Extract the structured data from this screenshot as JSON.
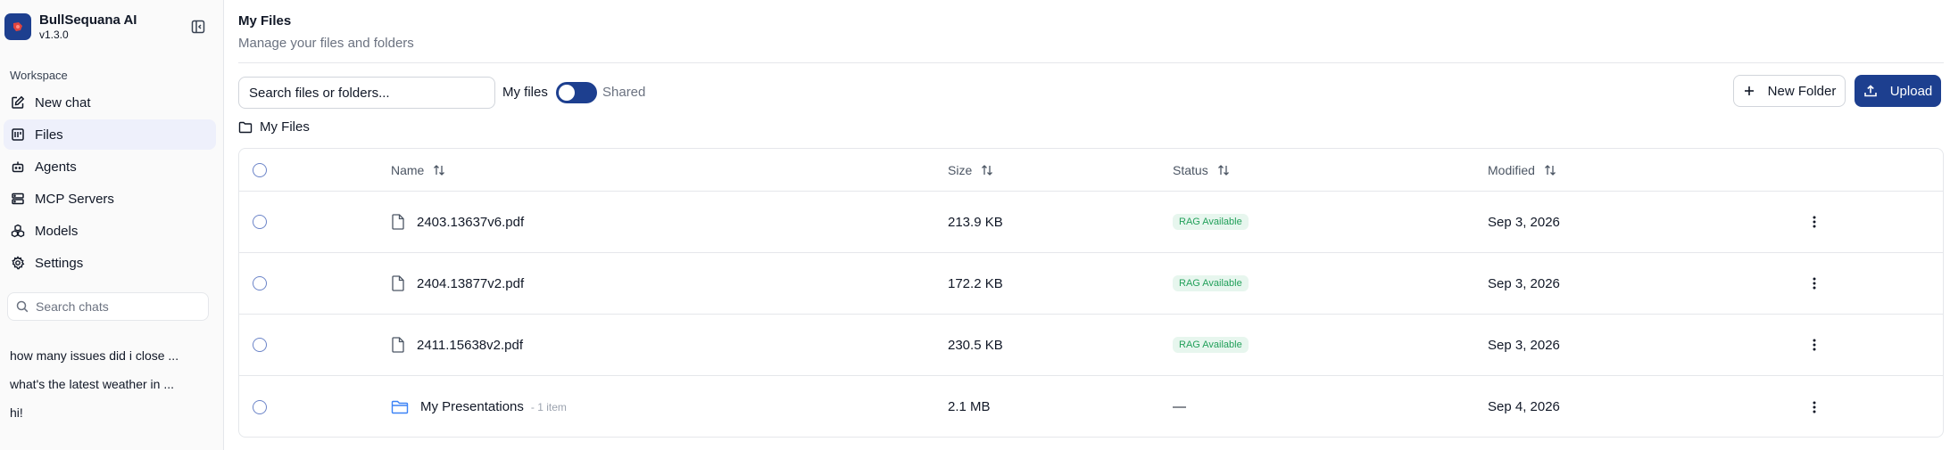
{
  "app": {
    "name": "BullSequana AI",
    "version": "v1.3.0"
  },
  "sidebar": {
    "workspace_label": "Workspace",
    "items": [
      {
        "label": "New chat",
        "icon": "edit-icon"
      },
      {
        "label": "Files",
        "icon": "files-icon",
        "active": true
      },
      {
        "label": "Agents",
        "icon": "bot-icon"
      },
      {
        "label": "MCP Servers",
        "icon": "server-icon"
      },
      {
        "label": "Models",
        "icon": "cubes-icon"
      },
      {
        "label": "Settings",
        "icon": "gear-icon"
      }
    ],
    "search_placeholder": "Search chats",
    "history": [
      "how many issues did i close ...",
      "what's the latest weather in ...",
      "hi!"
    ]
  },
  "page": {
    "title": "My Files",
    "subtitle": "Manage your files and folders"
  },
  "toolbar": {
    "search_placeholder": "Search files or folders...",
    "my_files_label": "My files",
    "shared_label": "Shared",
    "toggle_on": true,
    "new_folder_label": "New Folder",
    "upload_label": "Upload"
  },
  "breadcrumb": {
    "label": "My Files"
  },
  "table": {
    "columns": {
      "name": "Name",
      "size": "Size",
      "status": "Status",
      "modified": "Modified"
    },
    "rows": [
      {
        "type": "file",
        "name": "2403.13637v6.pdf",
        "count": "",
        "size": "213.9 KB",
        "status": "RAG Available",
        "modified": "Sep 3, 2026"
      },
      {
        "type": "file",
        "name": "2404.13877v2.pdf",
        "count": "",
        "size": "172.2 KB",
        "status": "RAG Available",
        "modified": "Sep 3, 2026"
      },
      {
        "type": "file",
        "name": "2411.15638v2.pdf",
        "count": "",
        "size": "230.5 KB",
        "status": "RAG Available",
        "modified": "Sep 3, 2026"
      },
      {
        "type": "folder",
        "name": "My Presentations",
        "count": "- 1 item",
        "size": "2.1 MB",
        "status": "—",
        "modified": "Sep 4, 2026"
      }
    ]
  },
  "colors": {
    "accent": "#1d3f8f",
    "badge_bg": "#e7f6ee",
    "badge_text": "#22a05a",
    "folder": "#3b82f6"
  }
}
